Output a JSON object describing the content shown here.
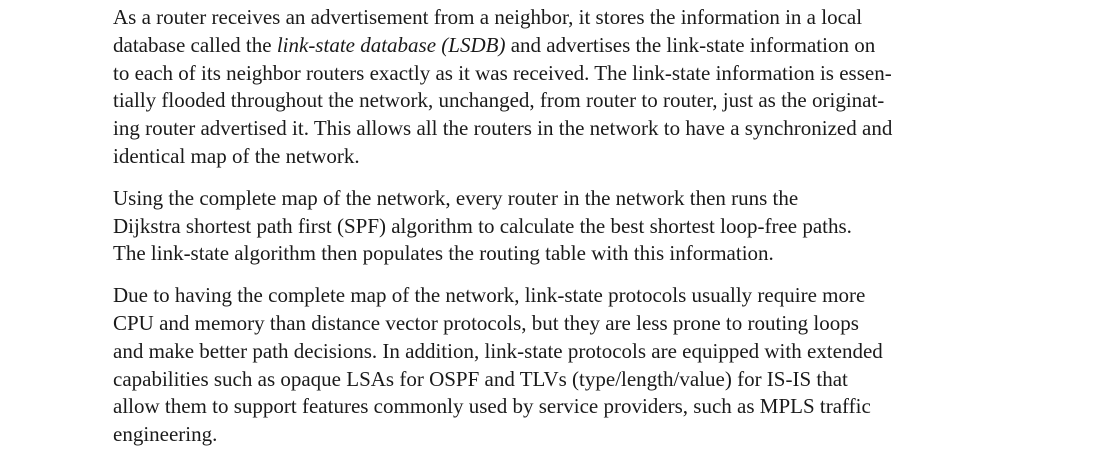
{
  "paragraphs": [
    {
      "lines": [
        [
          "As a router receives an advertisement from a neighbor, it stores the information in a local"
        ],
        [
          "database called the ",
          "link-state database (LSDB)",
          " and advertises the link-state information on"
        ],
        [
          "to each of its neighbor routers exactly as it was received. The link-state information is essen-"
        ],
        [
          "tially flooded throughout the network, unchanged, from router to router, just as the originat-"
        ],
        [
          "ing router advertised it. This allows all the routers in the network to have a synchronized and"
        ],
        [
          "identical map of the network."
        ]
      ]
    },
    {
      "lines": [
        [
          "Using the complete map of the network, every router in the network then runs the"
        ],
        [
          "Dijkstra shortest path first (SPF) algorithm to calculate the best shortest loop-free paths."
        ],
        [
          "The link-state algorithm then populates the routing table with this information."
        ]
      ]
    },
    {
      "lines": [
        [
          "Due to having the complete map of the network, link-state protocols usually require more"
        ],
        [
          "CPU and memory than distance vector protocols, but they are less prone to routing loops"
        ],
        [
          "and make better path decisions. In addition, link-state protocols are equipped with extended"
        ],
        [
          "capabilities such as opaque LSAs for OSPF and TLVs (type/length/value) for IS-IS that"
        ],
        [
          "allow them to support features commonly used by service providers, such as MPLS traffic"
        ],
        [
          "engineering."
        ]
      ]
    }
  ]
}
